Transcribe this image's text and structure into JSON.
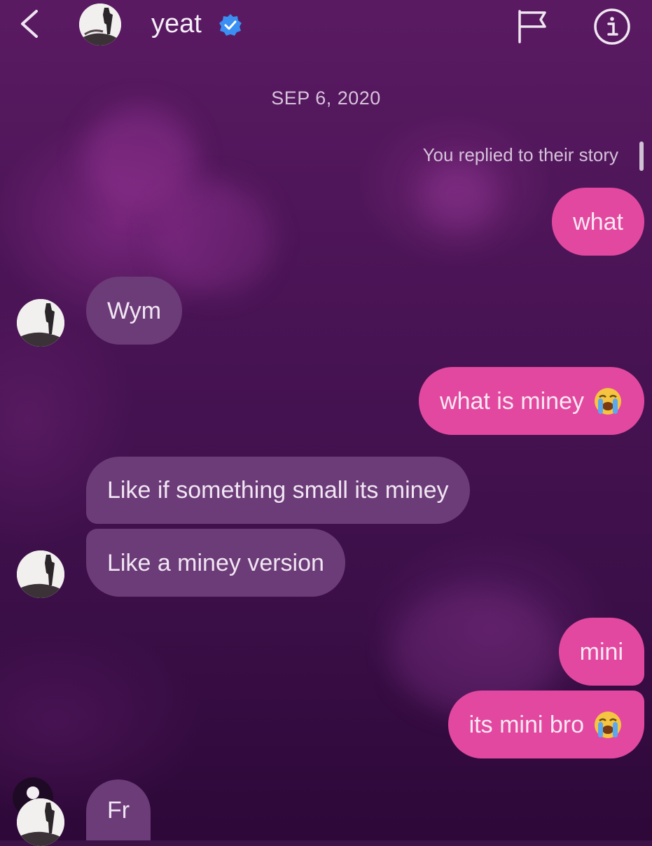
{
  "header": {
    "back_icon": "chevron-left-icon",
    "username": "yeat",
    "verified_icon": "verified-badge-icon",
    "flag_icon": "flag-icon",
    "info_icon": "info-icon"
  },
  "conversation": {
    "date": "SEP 6, 2020",
    "story_reply_note": "You replied to their story",
    "messages": [
      {
        "from": "me",
        "text": "what"
      },
      {
        "from": "them",
        "text": "Wym"
      },
      {
        "from": "me",
        "text": "what is miney",
        "emoji": "loudly-crying-face-icon"
      },
      {
        "from": "them",
        "text": "Like if something small its miney"
      },
      {
        "from": "them",
        "text": "Like a miney version"
      },
      {
        "from": "me",
        "text": "mini"
      },
      {
        "from": "me",
        "text": "its mini bro",
        "emoji": "loudly-crying-face-icon"
      },
      {
        "from": "them",
        "text": "Fr"
      }
    ]
  },
  "colors": {
    "outgoing_bubble": "#e2489f",
    "incoming_bubble": "#6c3c78",
    "background": "#4a1455",
    "verified_badge": "#3b8ff3"
  }
}
